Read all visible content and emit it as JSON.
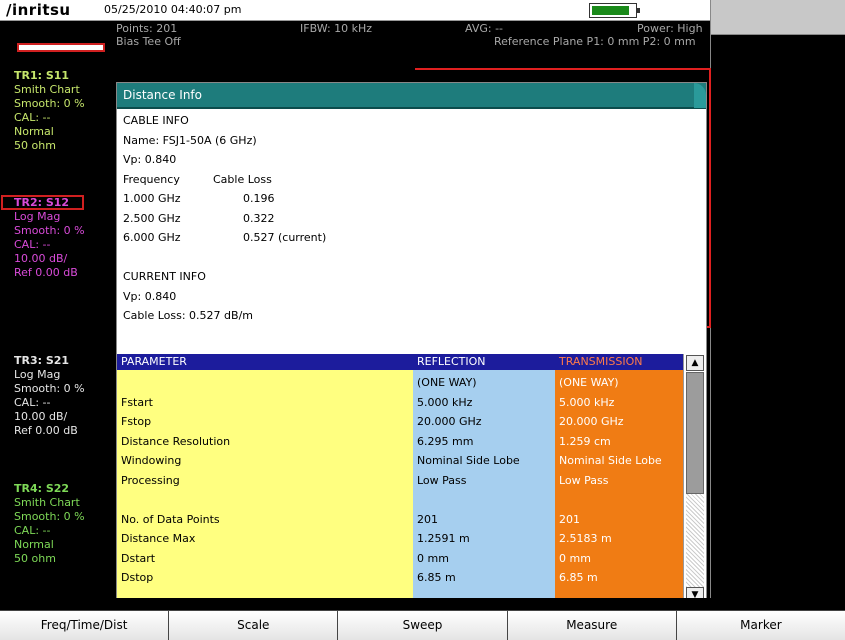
{
  "header": {
    "brand": "/inritsu",
    "datetime": "05/25/2010 04:40:07 pm",
    "points": "Points: 201",
    "ifbw": "IFBW: 10 kHz",
    "avg": "AVG: --",
    "power": "Power: High",
    "bias_tee": "Bias Tee Off",
    "reference_plane": "Reference Plane P1: 0 mm P2: 0 mm"
  },
  "traces": [
    {
      "name": "TR1: S11",
      "lines": [
        "Smith Chart",
        "Smooth: 0 %",
        "CAL: --",
        "Normal",
        "50 ohm"
      ]
    },
    {
      "name": "TR2: S12",
      "lines": [
        "Log Mag",
        "Smooth: 0 %",
        "CAL: --",
        "10.00 dB/",
        "Ref 0.00 dB"
      ]
    },
    {
      "name": "TR3: S21",
      "lines": [
        "Log Mag",
        "Smooth: 0 %",
        "CAL: --",
        "10.00 dB/",
        "Ref 0.00 dB"
      ]
    },
    {
      "name": "TR4: S22",
      "lines": [
        "Smith Chart",
        "Smooth: 0 %",
        "CAL: --",
        "Normal",
        "50 ohm"
      ]
    }
  ],
  "dialog": {
    "title": "Distance Info",
    "cable_info_title": "CABLE INFO",
    "cable_name": "Name: FSJ1-50A (6 GHz)",
    "vp": "Vp: 0.840",
    "freq_header": "Frequency",
    "loss_header": "Cable Loss",
    "cable_rows": [
      {
        "freq": "1.000 GHz",
        "loss": "0.196"
      },
      {
        "freq": "2.500 GHz",
        "loss": "0.322"
      },
      {
        "freq": "6.000 GHz",
        "loss": "0.527 (current)"
      }
    ],
    "current_info_title": "CURRENT INFO",
    "current_vp": "Vp: 0.840",
    "current_loss": "Cable Loss: 0.527 dB/m"
  },
  "table": {
    "headers": {
      "parameter": "PARAMETER",
      "reflection": "REFLECTION",
      "transmission": "TRANSMISSION"
    },
    "parameters": [
      "",
      "Fstart",
      "Fstop",
      "Distance Resolution",
      "Windowing",
      "Processing",
      "",
      "No. of Data Points",
      "Distance Max",
      "Dstart",
      "Dstop"
    ],
    "reflection": [
      "(ONE WAY)",
      "5.000 kHz",
      "20.000 GHz",
      "6.295 mm",
      "Nominal Side Lobe",
      "Low Pass",
      "",
      "201",
      "1.2591 m",
      "0 mm",
      "6.85 m"
    ],
    "transmission": [
      "(ONE WAY)",
      "5.000 kHz",
      "20.000 GHz",
      "1.259 cm",
      "Nominal Side Lobe",
      "Low Pass",
      "",
      "201",
      "2.5183 m",
      "0 mm",
      "6.85 m"
    ]
  },
  "softkeys": [
    "Freq/Time/Dist",
    "Scale",
    "Sweep",
    "Measure",
    "Marker"
  ],
  "colors": {
    "title_bar": "#1e7c7c",
    "param_col": "#ffff80",
    "reflection_col": "#a6cfef",
    "transmission_col": "#f07c14",
    "table_header": "#1c1c9c"
  }
}
